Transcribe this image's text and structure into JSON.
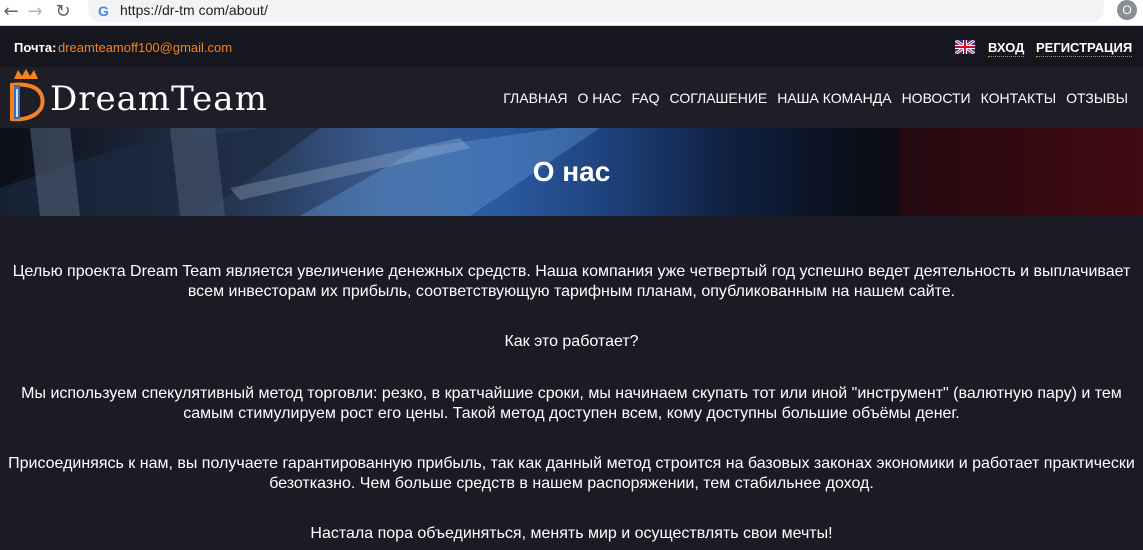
{
  "browser": {
    "url": "https://dr-tm com/about/",
    "profile_initial": "O",
    "back_icon": "arrow-left-icon",
    "forward_icon": "arrow-right-icon",
    "reload_icon": "reload-icon"
  },
  "topbar": {
    "mail_label": "Почта:",
    "mail_value": "dreamteamoff100@gmail.com",
    "login_label": "ВХОД",
    "register_label": "РЕГИСТРАЦИЯ",
    "language_flag": "uk-flag-icon"
  },
  "header": {
    "logo_text": "DreamTeam",
    "nav": [
      {
        "label": "ГЛАВНАЯ"
      },
      {
        "label": "О НАС"
      },
      {
        "label": "FAQ"
      },
      {
        "label": "СОГЛАШЕНИЕ"
      },
      {
        "label": "НАША КОМАНДА"
      },
      {
        "label": "НОВОСТИ"
      },
      {
        "label": "КОНТАКТЫ"
      },
      {
        "label": "ОТЗЫВЫ"
      }
    ]
  },
  "hero": {
    "title": "О нас"
  },
  "content": {
    "paragraphs": [
      "Целью проекта Dream Team является увеличение денежных средств. Наша компания уже четвертый год успешно ведет деятельность и выплачивает всем инвесторам их прибыль, соответствующую тарифным планам, опубликованным на нашем сайте.",
      "Как это работает?",
      "Мы используем спекулятивный метод торговли: резко, в кратчайшие сроки, мы начинаем скупать тот или иной \"инструмент\" (валютную пару) и тем самым стимулируем рост его цены. Такой метод доступен всем, кому доступны большие объёмы денег.",
      "Присоединяясь к нам, вы получаете гарантированную прибыль, так как данный метод строится на базовых законах экономики и работает практически безотказно. Чем больше средств в нашем распоряжении, тем стабильнее доход.",
      "Настала пора объединяться, менять мир и осуществлять свои мечты!"
    ]
  },
  "colors": {
    "accent": "#f5821f",
    "background": "#1b1b25",
    "text": "#ffffff"
  }
}
